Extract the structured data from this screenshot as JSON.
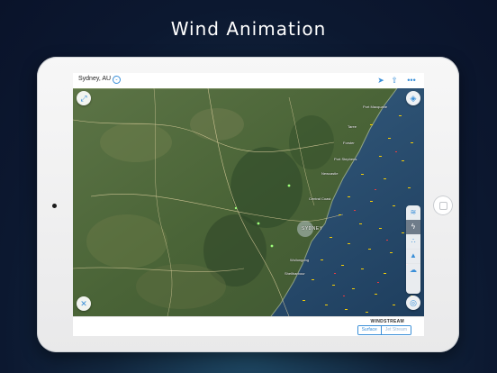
{
  "headline": "Wind Animation",
  "app": {
    "location": "Sydney, AU",
    "toolbar": {
      "locate_icon": "navigation-arrow-icon",
      "share_icon": "share-icon",
      "more_icon": "more-dots-icon"
    },
    "map": {
      "cities": [
        {
          "label": "Port Macquarie",
          "big": false
        },
        {
          "label": "Taree",
          "big": false
        },
        {
          "label": "Forster",
          "big": false
        },
        {
          "label": "Port Stephens",
          "big": false
        },
        {
          "label": "Newcastle",
          "big": false
        },
        {
          "label": "Central Coast",
          "big": false
        },
        {
          "label": "SYDNEY",
          "big": true
        },
        {
          "label": "Wollongong",
          "big": false
        },
        {
          "label": "Shellharbour",
          "big": false
        }
      ],
      "layers": [
        {
          "name": "wind-layer-icon",
          "glyph": "≋",
          "active": false
        },
        {
          "name": "lightning-layer-icon",
          "glyph": "ϟ",
          "active": true
        },
        {
          "name": "rain-layer-icon",
          "glyph": "∴",
          "active": false
        },
        {
          "name": "snow-layer-icon",
          "glyph": "▲",
          "active": false
        },
        {
          "name": "cloud-layer-icon",
          "glyph": "☁",
          "active": false
        }
      ]
    },
    "bottom": {
      "title": "WINDSTREAM",
      "options": [
        "Surface",
        "Jet Stream"
      ],
      "selected": "Surface"
    },
    "colors": {
      "accent": "#3a8fd8",
      "ocean": "#2a4c6e",
      "land": "#4f6b3a",
      "wind_marks": "#ffd400"
    }
  }
}
